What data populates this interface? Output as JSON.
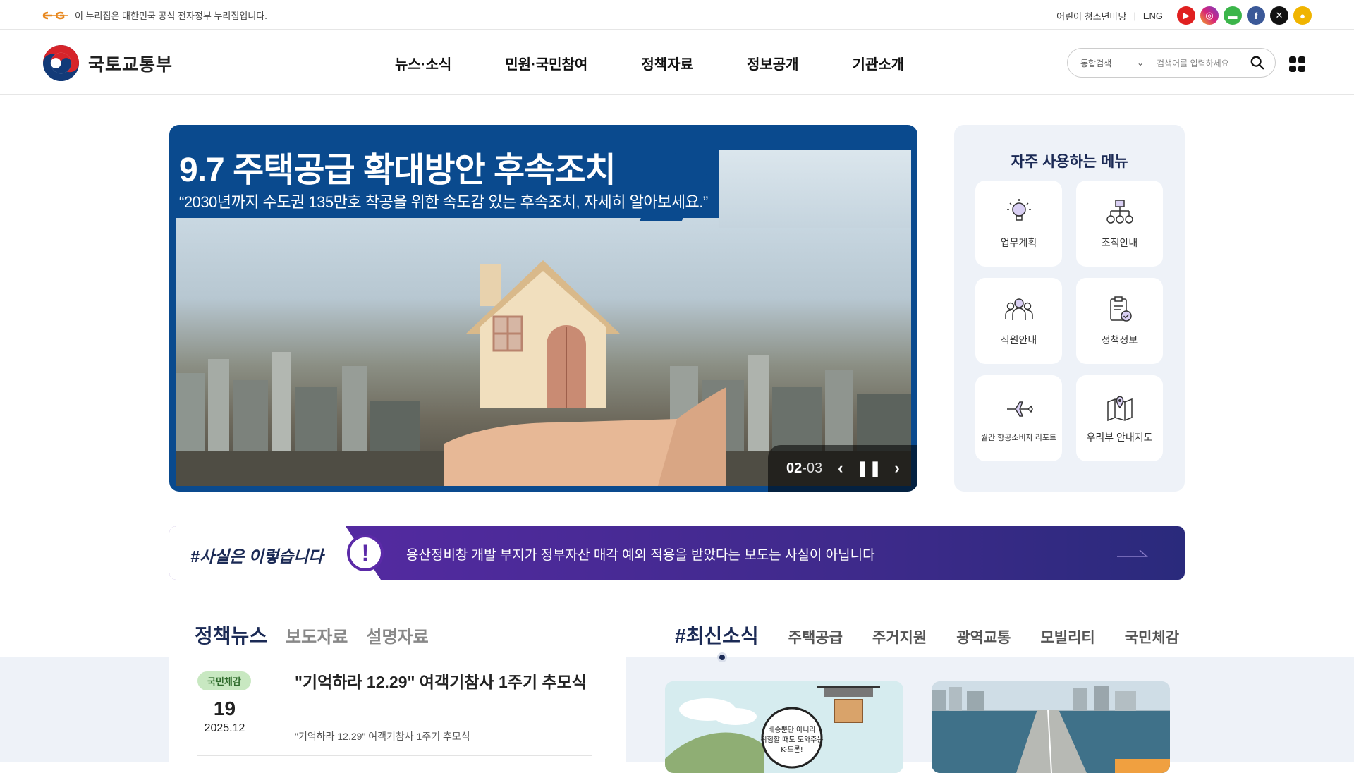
{
  "topbar": {
    "gov_notice": "이 누리집은 대한민국 공식 전자정부 누리집입니다.",
    "util_kids": "어린이 청소년마당",
    "util_eng": "ENG",
    "social": [
      {
        "icon": "youtube-icon",
        "color": "#e02020"
      },
      {
        "icon": "instagram-icon",
        "color": "#d6247a"
      },
      {
        "icon": "line-icon",
        "color": "#3bb54a"
      },
      {
        "icon": "facebook-icon",
        "color": "#3b5998"
      },
      {
        "icon": "x-icon",
        "color": "#111111"
      },
      {
        "icon": "kakao-icon",
        "color": "#f0b400"
      }
    ]
  },
  "header": {
    "logo_text": "국토교통부",
    "nav": [
      "뉴스·소식",
      "민원·국민참여",
      "정책자료",
      "정보공개",
      "기관소개"
    ],
    "search_scope": "통합검색",
    "search_placeholder": "검색어를 입력하세요"
  },
  "banner": {
    "title": "9.7 주택공급 확대방안 후속조치",
    "subtitle": "“2030년까지 수도권 135만호 착공을 위한 속도감 있는 후속조치, 자세히 알아보세요.”",
    "current": "02",
    "total": "-03"
  },
  "quick_menu": {
    "title": "자주 사용하는 메뉴",
    "items": [
      {
        "label": "업무계획",
        "icon": "lightbulb-icon"
      },
      {
        "label": "조직안내",
        "icon": "org-chart-icon"
      },
      {
        "label": "직원안내",
        "icon": "people-icon"
      },
      {
        "label": "정책정보",
        "icon": "clipboard-check-icon"
      },
      {
        "label": "월간 항공소비자 리포트",
        "icon": "airplane-icon"
      },
      {
        "label": "우리부 안내지도",
        "icon": "map-pin-icon"
      }
    ]
  },
  "fact_check": {
    "label": "#사실은 이렇습니다",
    "message": "용산정비창 개발 부지가 정부자산 매각 예외 적용을 받았다는 보도는 사실이 아닙니다"
  },
  "policy_news": {
    "tabs": [
      "정책뉴스",
      "보도자료",
      "설명자료"
    ],
    "item": {
      "badge": "국민체감",
      "day": "19",
      "year_month": "2025.12",
      "title": "\"기억하라 12.29\" 여객기참사 1주기 추모식",
      "desc": "\"기억하라 12.29\" 여객기참사 1주기 추모식"
    }
  },
  "latest": {
    "tabs": [
      "#최신소식",
      "주택공급",
      "주거지원",
      "광역교통",
      "모빌리티",
      "국민체감"
    ],
    "thumb1_caption": "배송뿐만 아니라 위험할 때도 도와주는 K-드론!"
  }
}
